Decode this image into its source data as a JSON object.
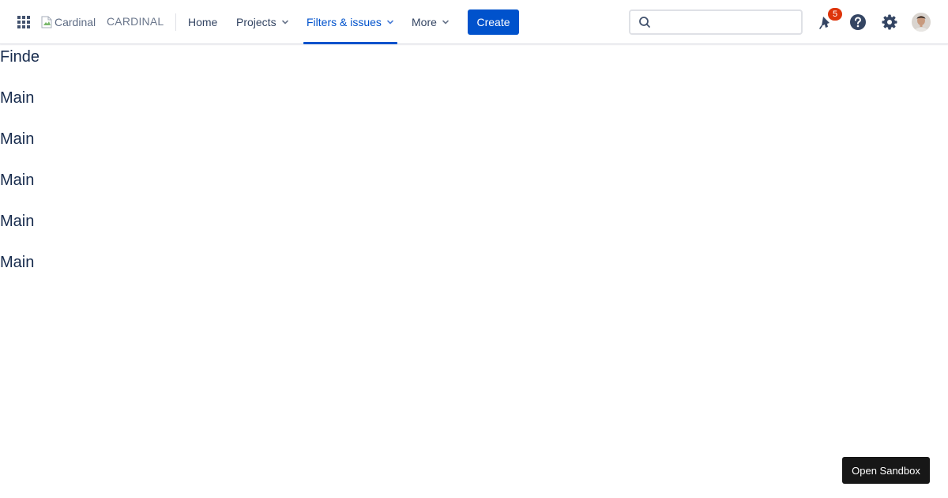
{
  "topbar": {
    "logo_alt": "Cardinal",
    "site_name": "CARDINAL",
    "nav": [
      {
        "label": "Home",
        "dropdown": false,
        "active": false
      },
      {
        "label": "Projects",
        "dropdown": true,
        "active": false
      },
      {
        "label": "Filters & issues",
        "dropdown": true,
        "active": true
      },
      {
        "label": "More",
        "dropdown": true,
        "active": false
      }
    ],
    "create_label": "Create",
    "search": {
      "value": "",
      "placeholder": ""
    },
    "notifications_count": "5",
    "icons": [
      "app-switcher-icon",
      "search-icon",
      "notifications-icon",
      "help-icon",
      "settings-icon",
      "avatar"
    ]
  },
  "main": {
    "lines": [
      "Finde",
      "Main",
      "Main",
      "Main",
      "Main",
      "Main"
    ]
  },
  "sandbox_label": "Open Sandbox",
  "colors": {
    "accent": "#0052cc",
    "text": "#172b4d",
    "badge": "#de350b",
    "sandbox_bg": "#171717"
  }
}
